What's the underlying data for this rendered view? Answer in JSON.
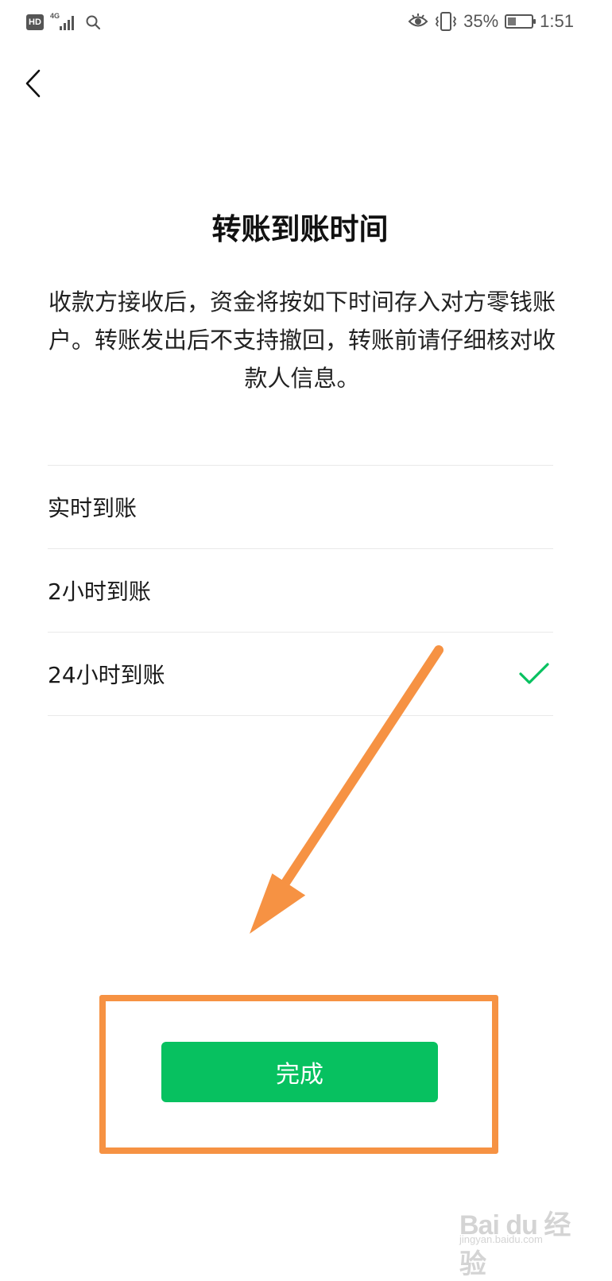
{
  "status_bar": {
    "hd": "HD",
    "network": "4G",
    "battery_percent": "35%",
    "battery_level": 0.35,
    "time": "1:51"
  },
  "page": {
    "title": "转账到账时间",
    "description": "收款方接收后，资金将按如下时间存入对方零钱账户。转账发出后不支持撤回，转账前请仔细核对收款人信息。"
  },
  "options": [
    {
      "label": "实时到账",
      "selected": false
    },
    {
      "label": "2小时到账",
      "selected": false
    },
    {
      "label": "24小时到账",
      "selected": true
    }
  ],
  "done_button": {
    "label": "完成"
  },
  "colors": {
    "accent": "#07c160",
    "annotation": "#f69243"
  },
  "watermark": {
    "brand": "Bai du 经验",
    "url": "jingyan.baidu.com"
  }
}
